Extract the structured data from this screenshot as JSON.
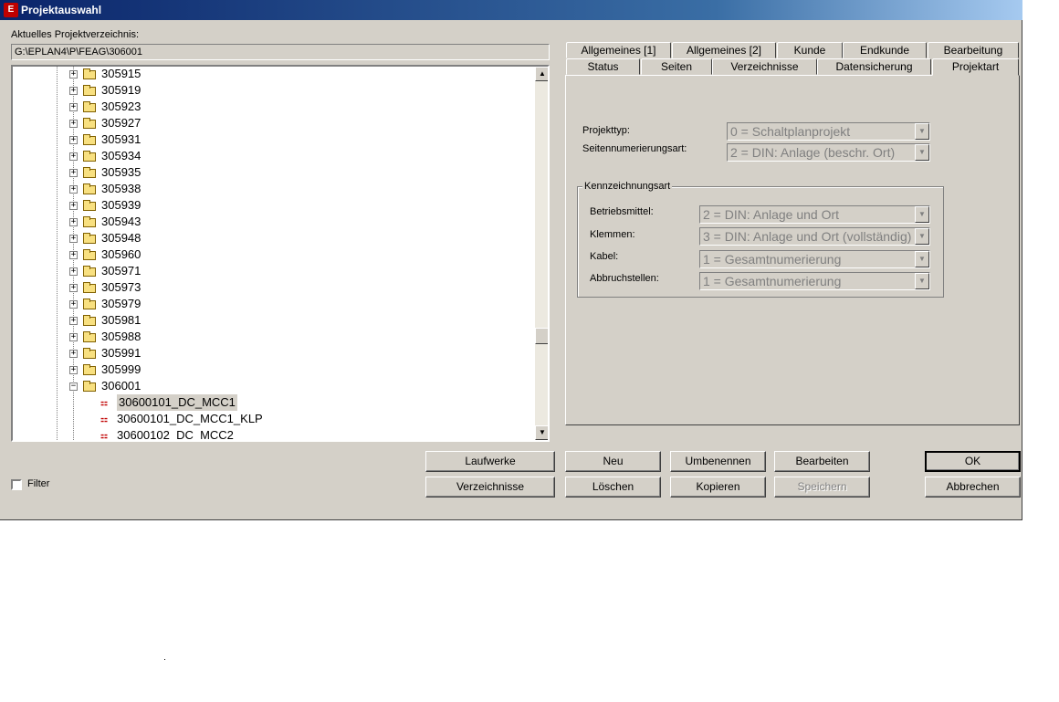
{
  "window": {
    "title": "Projektauswahl",
    "icon": "eplan-app-icon"
  },
  "directory": {
    "label": "Aktuelles Projektverzeichnis:",
    "path": "G:\\EPLAN4\\P\\FEAG\\306001"
  },
  "tree": {
    "folders": [
      "305915",
      "305919",
      "305923",
      "305927",
      "305931",
      "305934",
      "305935",
      "305938",
      "305939",
      "305943",
      "305948",
      "305960",
      "305971",
      "305973",
      "305979",
      "305981",
      "305988",
      "305991",
      "305999"
    ],
    "open_folder": "306001",
    "projects": [
      "30600101_DC_MCC1",
      "30600101_DC_MCC1_KLP",
      "30600102_DC_MCC2"
    ],
    "selected_project": "30600101_DC_MCC1"
  },
  "tabs": {
    "row1": [
      "Allgemeines [1]",
      "Allgemeines [2]",
      "Kunde",
      "Endkunde",
      "Bearbeitung"
    ],
    "row2": [
      "Status",
      "Seiten",
      "Verzeichnisse",
      "Datensicherung",
      "Projektart"
    ],
    "active": "Projektart"
  },
  "projektart": {
    "projekttyp_label": "Projekttyp:",
    "projekttyp_value": "0 = Schaltplanprojekt",
    "seitennum_label": "Seitennumerierungsart:",
    "seitennum_value": "2 = DIN: Anlage (beschr. Ort)",
    "group_title": "Kennzeichnungsart",
    "betriebsmittel_label": "Betriebsmittel:",
    "betriebsmittel_value": "2 = DIN: Anlage und Ort",
    "klemmen_label": "Klemmen:",
    "klemmen_value": "3 = DIN: Anlage und Ort (vollständig)",
    "kabel_label": "Kabel:",
    "kabel_value": "1 = Gesamtnumerierung",
    "abbruch_label": "Abbruchstellen:",
    "abbruch_value": "1 = Gesamtnumerierung"
  },
  "buttons": {
    "laufwerke": "Laufwerke",
    "verzeichnisse": "Verzeichnisse",
    "neu": "Neu",
    "loeschen": "Löschen",
    "umbenennen": "Umbenennen",
    "kopieren": "Kopieren",
    "bearbeiten": "Bearbeiten",
    "speichern": "Speichern",
    "ok": "OK",
    "abbrechen": "Abbrechen"
  },
  "filter": {
    "label": "Filter",
    "checked": false
  }
}
